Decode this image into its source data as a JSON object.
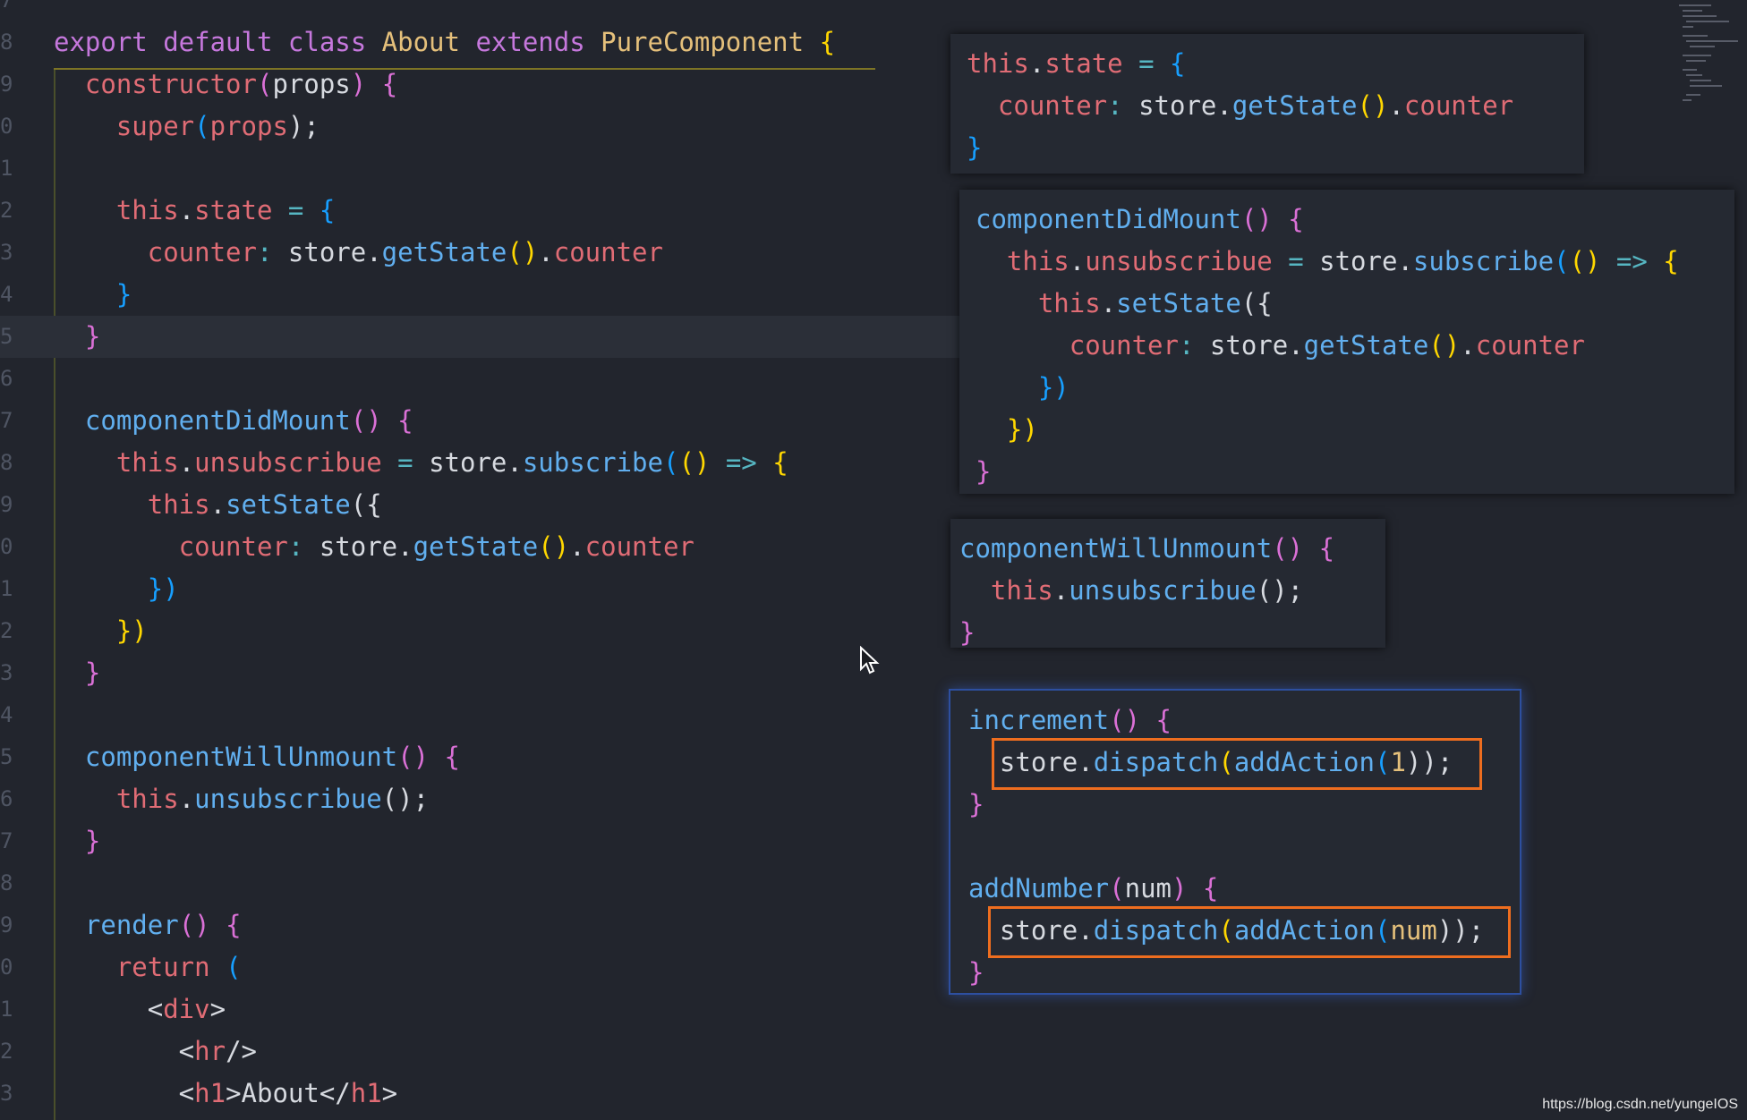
{
  "editor": {
    "line_numbers": [
      "7",
      "8",
      "9",
      "0",
      "1",
      "2",
      "3",
      "4",
      "5",
      "6",
      "7",
      "8",
      "9",
      "0",
      "1",
      "2",
      "3",
      "4",
      "5",
      "6",
      "7",
      "8",
      "9",
      "0",
      "1",
      "2",
      "3"
    ],
    "lines": [
      [],
      [
        {
          "t": "export ",
          "c": "kw"
        },
        {
          "t": "default ",
          "c": "kw"
        },
        {
          "t": "class ",
          "c": "kw"
        },
        {
          "t": "About ",
          "c": "nm"
        },
        {
          "t": "extends ",
          "c": "kw"
        },
        {
          "t": "PureComponent ",
          "c": "nm"
        },
        {
          "t": "{",
          "c": "br1"
        }
      ],
      [
        {
          "t": "  constructor",
          "c": "th"
        },
        {
          "t": "(",
          "c": "br2"
        },
        {
          "t": "props",
          "c": "pl"
        },
        {
          "t": ") ",
          "c": "br2"
        },
        {
          "t": "{",
          "c": "br2"
        }
      ],
      [
        {
          "t": "    super",
          "c": "th"
        },
        {
          "t": "(",
          "c": "br3"
        },
        {
          "t": "props",
          "c": "th"
        },
        {
          "t": ");",
          "c": "pl"
        }
      ],
      [],
      [
        {
          "t": "    this",
          "c": "th"
        },
        {
          "t": ".",
          "c": "pl"
        },
        {
          "t": "state",
          "c": "th"
        },
        {
          "t": " = ",
          "c": "op"
        },
        {
          "t": "{",
          "c": "br3"
        }
      ],
      [
        {
          "t": "      counter",
          "c": "th"
        },
        {
          "t": ": ",
          "c": "op"
        },
        {
          "t": "store.",
          "c": "pl"
        },
        {
          "t": "getState",
          "c": "fn"
        },
        {
          "t": "()",
          "c": "br1"
        },
        {
          "t": ".",
          "c": "pl"
        },
        {
          "t": "counter",
          "c": "th"
        }
      ],
      [
        {
          "t": "    }",
          "c": "br3"
        }
      ],
      [
        {
          "t": "  }",
          "c": "br2"
        }
      ],
      [],
      [
        {
          "t": "  componentDidMount",
          "c": "fn"
        },
        {
          "t": "() ",
          "c": "br2"
        },
        {
          "t": "{",
          "c": "br2"
        }
      ],
      [
        {
          "t": "    this",
          "c": "th"
        },
        {
          "t": ".",
          "c": "pl"
        },
        {
          "t": "unsubscribue",
          "c": "th"
        },
        {
          "t": " = ",
          "c": "op"
        },
        {
          "t": "store.",
          "c": "pl"
        },
        {
          "t": "subscribe",
          "c": "fn"
        },
        {
          "t": "(",
          "c": "br3"
        },
        {
          "t": "()",
          "c": "br1"
        },
        {
          "t": " => ",
          "c": "op"
        },
        {
          "t": "{",
          "c": "br1"
        }
      ],
      [
        {
          "t": "      this",
          "c": "th"
        },
        {
          "t": ".",
          "c": "pl"
        },
        {
          "t": "setState",
          "c": "fn"
        },
        {
          "t": "({",
          "c": "pl"
        }
      ],
      [
        {
          "t": "        counter",
          "c": "th"
        },
        {
          "t": ": ",
          "c": "op"
        },
        {
          "t": "store.",
          "c": "pl"
        },
        {
          "t": "getState",
          "c": "fn"
        },
        {
          "t": "()",
          "c": "br1"
        },
        {
          "t": ".",
          "c": "pl"
        },
        {
          "t": "counter",
          "c": "th"
        }
      ],
      [
        {
          "t": "      })",
          "c": "br3"
        }
      ],
      [
        {
          "t": "    })",
          "c": "br1"
        }
      ],
      [
        {
          "t": "  }",
          "c": "br2"
        }
      ],
      [],
      [
        {
          "t": "  componentWillUnmount",
          "c": "fn"
        },
        {
          "t": "() ",
          "c": "br2"
        },
        {
          "t": "{",
          "c": "br2"
        }
      ],
      [
        {
          "t": "    this",
          "c": "th"
        },
        {
          "t": ".",
          "c": "pl"
        },
        {
          "t": "unsubscribue",
          "c": "fn"
        },
        {
          "t": "();",
          "c": "pl"
        }
      ],
      [
        {
          "t": "  }",
          "c": "br2"
        }
      ],
      [],
      [
        {
          "t": "  render",
          "c": "fn"
        },
        {
          "t": "() ",
          "c": "br2"
        },
        {
          "t": "{",
          "c": "br2"
        }
      ],
      [
        {
          "t": "    return ",
          "c": "th"
        },
        {
          "t": "(",
          "c": "br3"
        }
      ],
      [
        {
          "t": "      <",
          "c": "pl"
        },
        {
          "t": "div",
          "c": "tg"
        },
        {
          "t": ">",
          "c": "pl"
        }
      ],
      [
        {
          "t": "        <",
          "c": "pl"
        },
        {
          "t": "hr",
          "c": "tg"
        },
        {
          "t": "/>",
          "c": "pl"
        }
      ],
      [
        {
          "t": "        <",
          "c": "pl"
        },
        {
          "t": "h1",
          "c": "tg"
        },
        {
          "t": ">About</",
          "c": "pl"
        },
        {
          "t": "h1",
          "c": "tg"
        },
        {
          "t": ">",
          "c": "pl"
        }
      ]
    ]
  },
  "panels": [
    {
      "name": "panel-state",
      "lines": [
        [
          {
            "t": "this",
            "c": "th"
          },
          {
            "t": ".",
            "c": "pl"
          },
          {
            "t": "state",
            "c": "th"
          },
          {
            "t": " = ",
            "c": "op"
          },
          {
            "t": "{",
            "c": "br3"
          }
        ],
        [
          {
            "t": "  counter",
            "c": "th"
          },
          {
            "t": ": ",
            "c": "op"
          },
          {
            "t": "store.",
            "c": "pl"
          },
          {
            "t": "getState",
            "c": "fn"
          },
          {
            "t": "()",
            "c": "br1"
          },
          {
            "t": ".",
            "c": "pl"
          },
          {
            "t": "counter",
            "c": "th"
          }
        ],
        [
          {
            "t": "}",
            "c": "br3"
          }
        ]
      ]
    },
    {
      "name": "panel-did-mount",
      "lines": [
        [
          {
            "t": "componentDidMount",
            "c": "fn"
          },
          {
            "t": "() ",
            "c": "br2"
          },
          {
            "t": "{",
            "c": "br2"
          }
        ],
        [
          {
            "t": "  this",
            "c": "th"
          },
          {
            "t": ".",
            "c": "pl"
          },
          {
            "t": "unsubscribue",
            "c": "th"
          },
          {
            "t": " = ",
            "c": "op"
          },
          {
            "t": "store.",
            "c": "pl"
          },
          {
            "t": "subscribe",
            "c": "fn"
          },
          {
            "t": "(",
            "c": "br3"
          },
          {
            "t": "()",
            "c": "br1"
          },
          {
            "t": " => ",
            "c": "op"
          },
          {
            "t": "{",
            "c": "br1"
          }
        ],
        [
          {
            "t": "    this",
            "c": "th"
          },
          {
            "t": ".",
            "c": "pl"
          },
          {
            "t": "setState",
            "c": "fn"
          },
          {
            "t": "({",
            "c": "pl"
          }
        ],
        [
          {
            "t": "      counter",
            "c": "th"
          },
          {
            "t": ": ",
            "c": "op"
          },
          {
            "t": "store.",
            "c": "pl"
          },
          {
            "t": "getState",
            "c": "fn"
          },
          {
            "t": "()",
            "c": "br1"
          },
          {
            "t": ".",
            "c": "pl"
          },
          {
            "t": "counter",
            "c": "th"
          }
        ],
        [
          {
            "t": "    })",
            "c": "br3"
          }
        ],
        [
          {
            "t": "  })",
            "c": "br1"
          }
        ],
        [
          {
            "t": "}",
            "c": "br2"
          }
        ]
      ]
    },
    {
      "name": "panel-will-unmount",
      "lines": [
        [
          {
            "t": "componentWillUnmount",
            "c": "fn"
          },
          {
            "t": "() ",
            "c": "br2"
          },
          {
            "t": "{",
            "c": "br2"
          }
        ],
        [
          {
            "t": "  this",
            "c": "th"
          },
          {
            "t": ".",
            "c": "pl"
          },
          {
            "t": "unsubscribue",
            "c": "fn"
          },
          {
            "t": "();",
            "c": "pl"
          }
        ],
        [
          {
            "t": "}",
            "c": "br2"
          }
        ]
      ]
    },
    {
      "name": "panel-actions",
      "lines": [
        [
          {
            "t": "increment",
            "c": "fn"
          },
          {
            "t": "() ",
            "c": "br2"
          },
          {
            "t": "{",
            "c": "br2"
          }
        ],
        [
          {
            "t": "  store.",
            "c": "pl"
          },
          {
            "t": "dispatch",
            "c": "fn"
          },
          {
            "t": "(",
            "c": "br1"
          },
          {
            "t": "addAction",
            "c": "fn"
          },
          {
            "t": "(",
            "c": "br3"
          },
          {
            "t": "1",
            "c": "nm"
          },
          {
            "t": "));",
            "c": "pl"
          }
        ],
        [
          {
            "t": "}",
            "c": "br2"
          }
        ],
        [],
        [
          {
            "t": "addNumber",
            "c": "fn"
          },
          {
            "t": "(",
            "c": "br2"
          },
          {
            "t": "num",
            "c": "pl"
          },
          {
            "t": ") ",
            "c": "br2"
          },
          {
            "t": "{",
            "c": "br2"
          }
        ],
        [
          {
            "t": "  store.",
            "c": "pl"
          },
          {
            "t": "dispatch",
            "c": "fn"
          },
          {
            "t": "(",
            "c": "br1"
          },
          {
            "t": "addAction",
            "c": "fn"
          },
          {
            "t": "(",
            "c": "br3"
          },
          {
            "t": "num",
            "c": "nm"
          },
          {
            "t": "))",
            "c": "pl"
          },
          {
            "t": ";",
            "c": "pl"
          }
        ],
        [
          {
            "t": "}",
            "c": "br2"
          }
        ]
      ]
    }
  ],
  "watermark": "https://blog.csdn.net/yungeIOS",
  "colors": {
    "background": "#22252d",
    "highlight_box": "#ee6d1f",
    "panel_glow": "#2d4fa0"
  }
}
